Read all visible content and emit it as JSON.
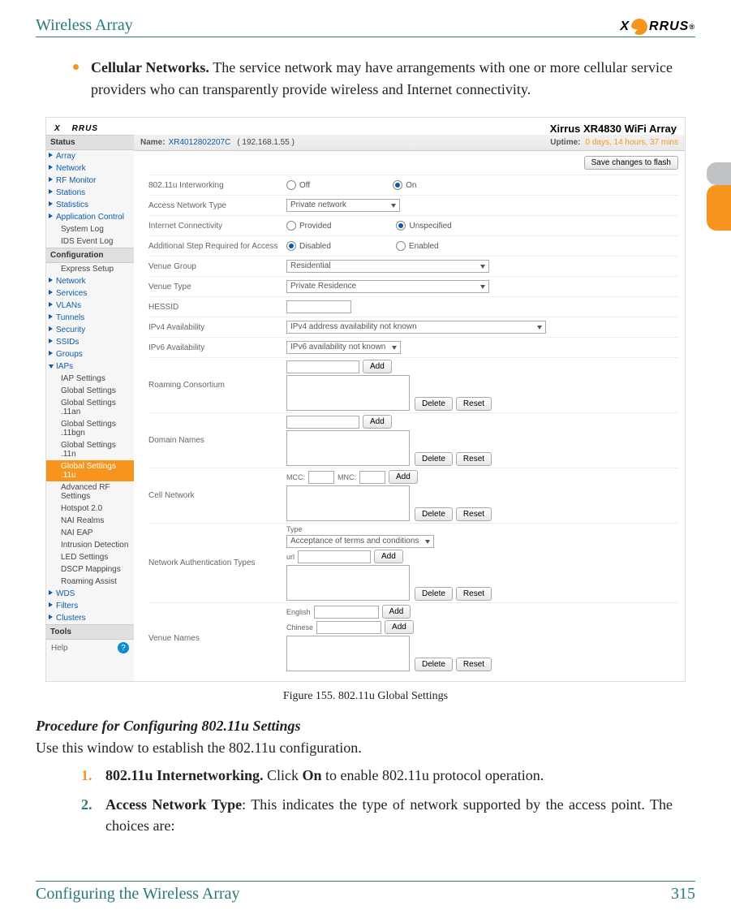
{
  "header": {
    "title": "Wireless Array",
    "logo_text_left": "X",
    "logo_text_right": "RRUS"
  },
  "side_tab": {},
  "bullet": {
    "strong": "Cellular Networks.",
    "text": " The service network may have arrangements with one or more cellular service providers who can transparently provide wireless and Internet connectivity."
  },
  "screenshot": {
    "logo_left": "X",
    "logo_right": "RRUS",
    "product": "Xirrus XR4830 WiFi Array",
    "status": {
      "name_lbl": "Name:",
      "name_val": "XR4012802207C",
      "ip": "( 192.168.1.55 )",
      "uptime_lbl": "Uptime:",
      "uptime_val": "0 days, 14 hours, 37 mins",
      "save_btn": "Save changes to flash"
    },
    "sidebar": {
      "status_hdr": "Status",
      "status_items": [
        "Array",
        "Network",
        "RF Monitor",
        "Stations",
        "Statistics",
        "Application Control"
      ],
      "status_subs": [
        "System Log",
        "IDS Event Log"
      ],
      "config_hdr": "Configuration",
      "config_items": [
        "Express Setup",
        "Network",
        "Services",
        "VLANs",
        "Tunnels",
        "Security",
        "SSIDs",
        "Groups"
      ],
      "iaps_label": "IAPs",
      "iap_subs": [
        "IAP Settings",
        "Global Settings",
        "Global Settings .11an",
        "Global Settings .11bgn",
        "Global Settings .11n",
        "Global Settings .11u",
        "Advanced RF Settings",
        "Hotspot 2.0",
        "NAI Realms",
        "NAI EAP",
        "Intrusion Detection",
        "LED Settings",
        "DSCP Mappings",
        "Roaming Assist"
      ],
      "tail_items": [
        "WDS",
        "Filters",
        "Clusters"
      ],
      "tools_hdr": "Tools",
      "help": "Help"
    },
    "form": {
      "interworking": {
        "lbl": "802.11u Interworking",
        "off": "Off",
        "on": "On"
      },
      "access_net": {
        "lbl": "Access Network Type",
        "val": "Private network"
      },
      "internet": {
        "lbl": "Internet Connectivity",
        "a": "Provided",
        "b": "Unspecified"
      },
      "addstep": {
        "lbl": "Additional Step Required for Access",
        "a": "Disabled",
        "b": "Enabled"
      },
      "venue_group": {
        "lbl": "Venue Group",
        "val": "Residential"
      },
      "venue_type": {
        "lbl": "Venue Type",
        "val": "Private Residence"
      },
      "hessid": {
        "lbl": "HESSID"
      },
      "ipv4": {
        "lbl": "IPv4 Availability",
        "val": "IPv4 address availability not known"
      },
      "ipv6": {
        "lbl": "IPv6 Availability",
        "val": "IPv6 availability not known"
      },
      "roaming": {
        "lbl": "Roaming Consortium"
      },
      "domain": {
        "lbl": "Domain Names"
      },
      "cell": {
        "lbl": "Cell Network",
        "mcc": "MCC:",
        "mnc": "MNC:"
      },
      "auth": {
        "lbl": "Network Authentication Types",
        "type_lbl": "Type",
        "type_val": "Acceptance of terms and conditions",
        "url_lbl": "url"
      },
      "venue_names": {
        "lbl": "Venue Names",
        "l1": "English",
        "l2": "Chinese"
      },
      "add": "Add",
      "delete": "Delete",
      "reset": "Reset"
    }
  },
  "figure_caption": "Figure 155. 802.11u Global Settings",
  "procedure": {
    "heading": "Procedure for Configuring 802.11u Settings",
    "intro": "Use this window to establish the 802.11u configuration.",
    "items": [
      {
        "n": "1.",
        "strong": "802.11u Internetworking.",
        "t1": " Click ",
        "b1": "On",
        "t2": " to enable 802.11u protocol operation."
      },
      {
        "n": "2.",
        "strong": "Access Network Type",
        "t": ": This indicates the type of network supported by the access point. The choices are:"
      }
    ]
  },
  "footer": {
    "left": "Configuring the Wireless Array",
    "right": "315"
  }
}
